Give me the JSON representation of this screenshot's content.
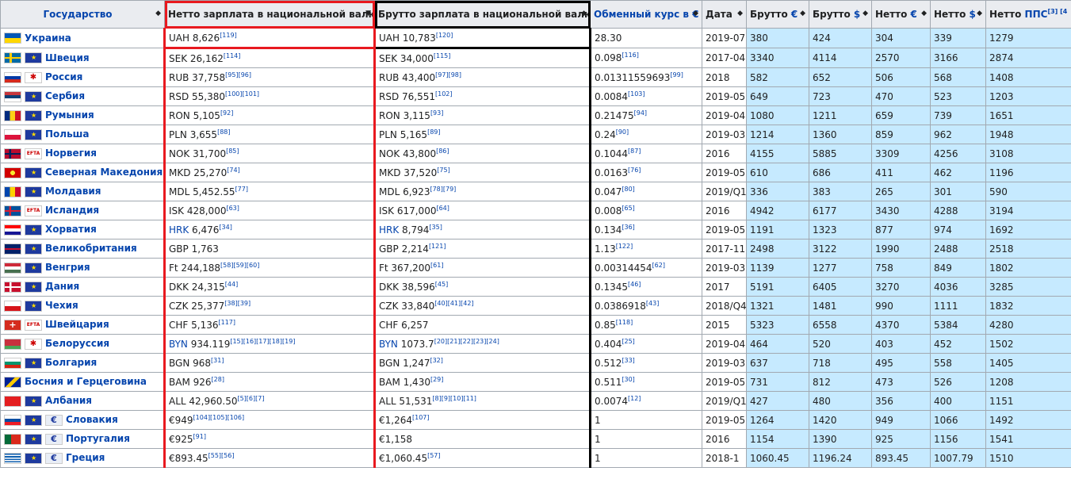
{
  "headers": [
    {
      "label": "Государство",
      "link": true
    },
    {
      "label": "Нетто зарплата в национальной валюте",
      "link": false
    },
    {
      "label": "Брутто зарплата в национальной валюте",
      "link": false
    },
    {
      "label": "Обменный курс в €",
      "link": true
    },
    {
      "label": "Дата",
      "link": false
    },
    {
      "label": "Брутто",
      "suffix": "€"
    },
    {
      "label": "Брутто",
      "suffix": "$"
    },
    {
      "label": "Нетто",
      "suffix": "€"
    },
    {
      "label": "Нетто",
      "suffix": "$"
    },
    {
      "label": "Нетто",
      "suffix": "ППС",
      "sup": "[3] [4"
    }
  ],
  "sort_symbols": {
    "both": "◆",
    "down": "▼"
  },
  "rows": [
    {
      "country": "Украина",
      "flags": [
        "ua"
      ],
      "net": "UAH 8,626",
      "net_sup": "[119]",
      "gross": "UAH 10,783",
      "gross_sup": "[120]",
      "rate": "28.30",
      "rate_sup": "",
      "date": "2019-07",
      "v": [
        "380",
        "424",
        "304",
        "339",
        "1279"
      ]
    },
    {
      "country": "Швеция",
      "flags": [
        "se",
        "eu"
      ],
      "net": "SEK 26,162",
      "net_sup": "[114]",
      "gross": "SEK 34,000",
      "gross_sup": "[115]",
      "rate": "0.098",
      "rate_sup": "[116]",
      "date": "2017-04",
      "v": [
        "3340",
        "4114",
        "2570",
        "3166",
        "2874"
      ]
    },
    {
      "country": "Россия",
      "flags": [
        "ru",
        "cis"
      ],
      "net": "RUB 37,758",
      "net_sup": "[95][96]",
      "gross": "RUB 43,400",
      "gross_sup": "[97][98]",
      "rate": "0.01311559693",
      "rate_sup": "[99]",
      "date": "2018",
      "v": [
        "582",
        "652",
        "506",
        "568",
        "1408"
      ]
    },
    {
      "country": "Сербия",
      "flags": [
        "rs",
        "eu"
      ],
      "net": "RSD 55,380",
      "net_sup": "[100][101]",
      "gross": "RSD 76,551",
      "gross_sup": "[102]",
      "rate": "0.0084",
      "rate_sup": "[103]",
      "date": "2019-05",
      "v": [
        "649",
        "723",
        "470",
        "523",
        "1203"
      ]
    },
    {
      "country": "Румыния",
      "flags": [
        "ro",
        "eu"
      ],
      "net": "RON 5,105",
      "net_sup": "[92]",
      "gross": "RON 3,115",
      "gross_sup": "[93]",
      "rate": "0.21475",
      "rate_sup": "[94]",
      "date": "2019-04",
      "v": [
        "1080",
        "1211",
        "659",
        "739",
        "1651"
      ]
    },
    {
      "country": "Польша",
      "flags": [
        "pl",
        "eu"
      ],
      "net": "PLN 3,655",
      "net_sup": "[88]",
      "gross": "PLN 5,165",
      "gross_sup": "[89]",
      "rate": "0.24",
      "rate_sup": "[90]",
      "date": "2019-03",
      "v": [
        "1214",
        "1360",
        "859",
        "962",
        "1948"
      ]
    },
    {
      "country": "Норвегия",
      "flags": [
        "no",
        "efta"
      ],
      "net": "NOK 31,700",
      "net_sup": "[85]",
      "gross": "NOK 43,800",
      "gross_sup": "[86]",
      "rate": "0.1044",
      "rate_sup": "[87]",
      "date": "2016",
      "v": [
        "4155",
        "5885",
        "3309",
        "4256",
        "3108"
      ]
    },
    {
      "country": "Северная Македония",
      "flags": [
        "mk",
        "eu"
      ],
      "net": "MKD 25,270",
      "net_sup": "[74]",
      "gross": "MKD 37,520",
      "gross_sup": "[75]",
      "rate": "0.0163",
      "rate_sup": "[76]",
      "date": "2019-05",
      "v": [
        "610",
        "686",
        "411",
        "462",
        "1196"
      ]
    },
    {
      "country": "Молдавия",
      "flags": [
        "md",
        "eu"
      ],
      "net": "MDL 5,452.55",
      "net_sup": "[77]",
      "gross": "MDL 6,923",
      "gross_sup": "[78][79]",
      "rate": "0.047",
      "rate_sup": "[80]",
      "date": "2019/Q1",
      "v": [
        "336",
        "383",
        "265",
        "301",
        "590"
      ]
    },
    {
      "country": "Исландия",
      "flags": [
        "is",
        "efta"
      ],
      "net": "ISK 428,000",
      "net_sup": "[63]",
      "gross": "ISK 617,000",
      "gross_sup": "[64]",
      "rate": "0.008",
      "rate_sup": "[65]",
      "date": "2016",
      "v": [
        "4942",
        "6177",
        "3430",
        "4288",
        "3194"
      ]
    },
    {
      "country": "Хорватия",
      "flags": [
        "hr",
        "eu"
      ],
      "net": "HRK 6,476",
      "net_sup": "[34]",
      "gross": "HRK 8,794",
      "gross_sup": "[35]",
      "rate": "0.134",
      "rate_sup": "[36]",
      "date": "2019-05",
      "v": [
        "1191",
        "1323",
        "877",
        "974",
        "1692"
      ],
      "hrk": true
    },
    {
      "country": "Великобритания",
      "flags": [
        "gb",
        "eu"
      ],
      "net": "GBP 1,763",
      "net_sup": "",
      "gross": "GBP 2,214",
      "gross_sup": "[121]",
      "rate": "1.13",
      "rate_sup": "[122]",
      "date": "2017-11",
      "v": [
        "2498",
        "3122",
        "1990",
        "2488",
        "2518"
      ]
    },
    {
      "country": "Венгрия",
      "flags": [
        "hu",
        "eu"
      ],
      "net": "Ft 244,188",
      "net_sup": "[58][59][60]",
      "gross": "Ft 367,200",
      "gross_sup": "[61]",
      "rate": "0.00314454",
      "rate_sup": "[62]",
      "date": "2019-03",
      "v": [
        "1139",
        "1277",
        "758",
        "849",
        "1802"
      ]
    },
    {
      "country": "Дания",
      "flags": [
        "dk",
        "eu"
      ],
      "net": "DKK 24,315",
      "net_sup": "[44]",
      "gross": "DKK 38,596",
      "gross_sup": "[45]",
      "rate": "0.1345",
      "rate_sup": "[46]",
      "date": "2017",
      "v": [
        "5191",
        "6405",
        "3270",
        "4036",
        "3285"
      ]
    },
    {
      "country": "Чехия",
      "flags": [
        "cz",
        "eu"
      ],
      "net": "CZK 25,377",
      "net_sup": "[38][39]",
      "gross": "CZK 33,840",
      "gross_sup": "[40][41][42]",
      "rate": "0.0386918",
      "rate_sup": "[43]",
      "date": "2018/Q4",
      "v": [
        "1321",
        "1481",
        "990",
        "1111",
        "1832"
      ]
    },
    {
      "country": "Швейцария",
      "flags": [
        "ch",
        "efta"
      ],
      "net": "CHF 5,136",
      "net_sup": "[117]",
      "gross": "CHF 6,257",
      "gross_sup": "",
      "rate": "0.85",
      "rate_sup": "[118]",
      "date": "2015",
      "v": [
        "5323",
        "6558",
        "4370",
        "5384",
        "4280"
      ]
    },
    {
      "country": "Белоруссия",
      "flags": [
        "by",
        "cis"
      ],
      "net": "BYN 934.119",
      "net_sup": "[15][16][17][18][19]",
      "gross": "BYN 1073.7",
      "gross_sup": "[20][21][22][23][24]",
      "rate": "0.404",
      "rate_sup": "[25]",
      "date": "2019-04",
      "v": [
        "464",
        "520",
        "403",
        "452",
        "1502"
      ],
      "byn": true
    },
    {
      "country": "Болгария",
      "flags": [
        "bg",
        "eu"
      ],
      "net": "BGN 968",
      "net_sup": "[31]",
      "gross": "BGN 1,247",
      "gross_sup": "[32]",
      "rate": "0.512",
      "rate_sup": "[33]",
      "date": "2019-03",
      "v": [
        "637",
        "718",
        "495",
        "558",
        "1405"
      ]
    },
    {
      "country": "Босния и Герцеговина",
      "flags": [
        "ba"
      ],
      "net": "BAM 926",
      "net_sup": "[28]",
      "gross": "BAM 1,430",
      "gross_sup": "[29]",
      "rate": "0.511",
      "rate_sup": "[30]",
      "date": "2019-05",
      "v": [
        "731",
        "812",
        "473",
        "526",
        "1208"
      ]
    },
    {
      "country": "Албания",
      "flags": [
        "al",
        "eu"
      ],
      "net": "ALL 42,960.50",
      "net_sup": "[5][6][7]",
      "gross": "ALL 51,531",
      "gross_sup": "[8][9][10][11]",
      "rate": "0.0074",
      "rate_sup": "[12]",
      "date": "2019/Q1",
      "v": [
        "427",
        "480",
        "356",
        "400",
        "1151"
      ]
    },
    {
      "country": "Словакия",
      "flags": [
        "sk",
        "eu",
        "euro"
      ],
      "net": "€949",
      "net_sup": "[104][105][106]",
      "gross": "€1,264",
      "gross_sup": "[107]",
      "rate": "1",
      "rate_sup": "",
      "date": "2019-05",
      "v": [
        "1264",
        "1420",
        "949",
        "1066",
        "1492"
      ]
    },
    {
      "country": "Португалия",
      "flags": [
        "pt",
        "eu",
        "euro"
      ],
      "net": "€925",
      "net_sup": "[91]",
      "gross": "€1,158",
      "gross_sup": "",
      "rate": "1",
      "rate_sup": "",
      "date": "2016",
      "v": [
        "1154",
        "1390",
        "925",
        "1156",
        "1541"
      ]
    },
    {
      "country": "Греция",
      "flags": [
        "gr",
        "eu",
        "euro"
      ],
      "net": "€893.45",
      "net_sup": "[55][56]",
      "gross": "€1,060.45",
      "gross_sup": "[57]",
      "rate": "1",
      "rate_sup": "",
      "date": "2018-1",
      "v": [
        "1060.45",
        "1196.24",
        "893.45",
        "1007.79",
        "1510"
      ]
    }
  ],
  "flag_styles": {
    "ua": "linear-gradient(#0057b7 50%, #ffd700 50%)",
    "se": "linear-gradient(90deg, transparent 30%, #fecc00 30%, #fecc00 44%, transparent 44%), linear-gradient(#006aa7 40%, #fecc00 40%, #fecc00 60%, #006aa7 60%)",
    "ru": "linear-gradient(#fff 33%, #0039a6 33%, #0039a6 66%, #d52b1e 66%)",
    "rs": "linear-gradient(#c6363c 33%, #0c4076 33%, #0c4076 66%, #fff 66%)",
    "ro": "linear-gradient(90deg, #002b7f 33%, #fcd116 33%, #fcd116 66%, #ce1126 66%)",
    "pl": "linear-gradient(#fff 50%, #dc143c 50%)",
    "no": "linear-gradient(90deg, transparent 28%, #00205b 28%, #00205b 40%, transparent 40%), linear-gradient(#ba0c2f 40%, #00205b 40%, #00205b 60%, #ba0c2f 60%)",
    "mk": "radial-gradient(circle, #f8e92e 25%, #d20000 26%)",
    "md": "linear-gradient(90deg, #0046ae 33%, #ffd200 33%, #ffd200 66%, #cc092f 66%)",
    "is": "linear-gradient(90deg, transparent 28%, #dc1e35 28%, #dc1e35 40%, transparent 40%), linear-gradient(#02529c 40%, #dc1e35 40%, #dc1e35 60%, #02529c 60%)",
    "hr": "linear-gradient(#ff0000 33%, #fff 33%, #fff 66%, #171796 66%)",
    "gb": "linear-gradient(#012169 40%, #c8102e 40%, #c8102e 60%, #012169 60%)",
    "hu": "linear-gradient(#ce2939 33%, #fff 33%, #fff 66%, #477050 66%)",
    "dk": "linear-gradient(90deg, transparent 30%, #fff 30%, #fff 42%, transparent 42%), linear-gradient(#c8102e 42%, #fff 42%, #fff 58%, #c8102e 58%)",
    "cz": "linear-gradient(#fff 50%, #d7141a 50%)",
    "ch": "#d52b1e",
    "by": "linear-gradient(#c8313e 66%, #4aa657 66%)",
    "bg": "linear-gradient(#fff 33%, #00966e 33%, #00966e 66%, #d62612 66%)",
    "ba": "linear-gradient(135deg, #002395 40%, #fecb00 40%, #fecb00 60%, #002395 60%)",
    "al": "#e41e20",
    "sk": "linear-gradient(#fff 33%, #0b4ea2 33%, #0b4ea2 66%, #ee1c25 66%)",
    "pt": "linear-gradient(90deg, #046a38 40%, #da291c 40%)",
    "gr": "repeating-linear-gradient(#0d5eaf 0 1.6px, #fff 1.6px 3.2px)"
  }
}
